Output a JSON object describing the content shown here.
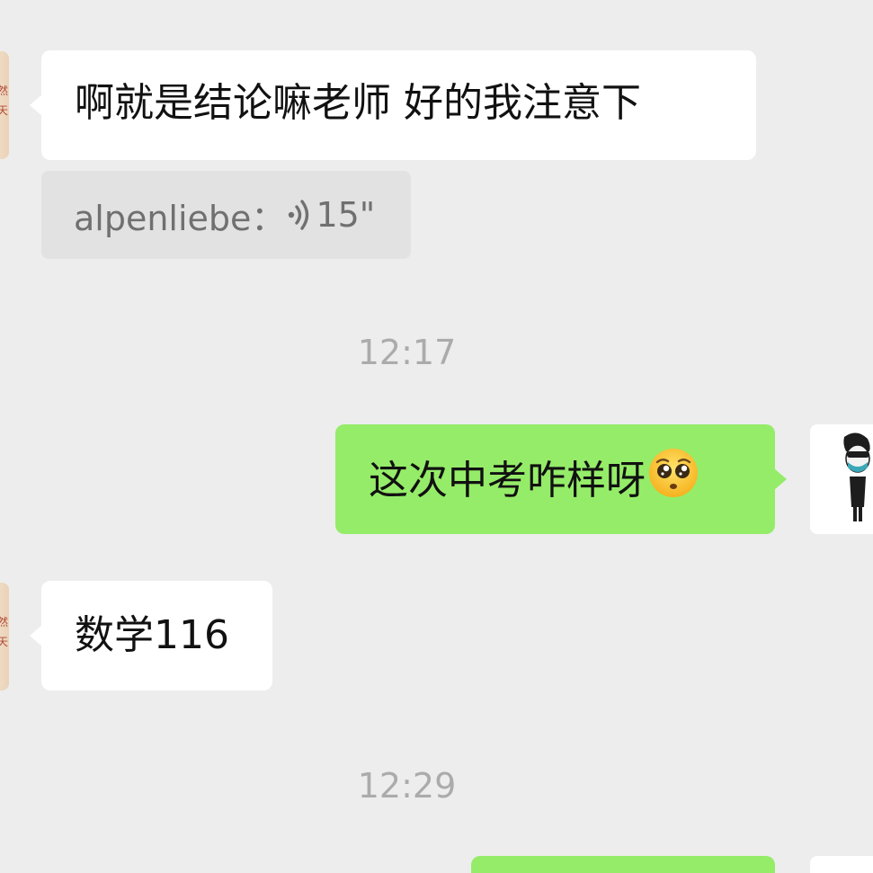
{
  "messages": [
    {
      "sender": "contact",
      "text": "啊就是结论嘛老师 好的我注意下"
    },
    {
      "sender": "contact",
      "type": "voice",
      "name": "alpenliebe：",
      "duration": "15\""
    },
    {
      "sender": "self",
      "text": "这次中考咋样呀",
      "emoji": "pleading-face"
    },
    {
      "sender": "contact",
      "text": "数学116"
    }
  ],
  "timestamps": [
    "12:17",
    "12:29"
  ],
  "contact_avatar": {
    "seal_chars": [
      "然",
      "天"
    ]
  },
  "colors": {
    "background": "#ededed",
    "incoming_bubble": "#ffffff",
    "outgoing_bubble": "#95ec69",
    "voice_box": "#e2e2e2",
    "timestamp_text": "#ababab"
  }
}
